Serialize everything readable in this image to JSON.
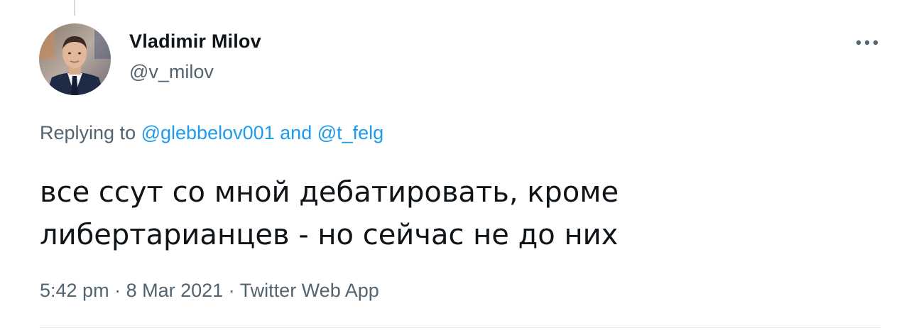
{
  "tweet": {
    "author": {
      "name": "Vladimir Milov",
      "handle": "@v_milov"
    },
    "reply": {
      "prefix": "Replying to ",
      "mention_1": "@glebbelov001",
      "joiner": " and ",
      "mention_2": "@t_felg"
    },
    "text": {
      "line_1": "все ссут со мной дебатировать, кроме",
      "line_2": "либертарианцев - но сейчас не до них"
    },
    "meta": {
      "time": "5:42 pm",
      "separator_1": " · ",
      "date": "8 Mar 2021",
      "separator_2": " · ",
      "source": "Twitter Web App"
    }
  },
  "colors": {
    "link": "#1d9bf0",
    "secondary_text": "#536471",
    "primary_text": "#0f1419"
  },
  "icons": {
    "more": "more-horizontal-icon"
  }
}
